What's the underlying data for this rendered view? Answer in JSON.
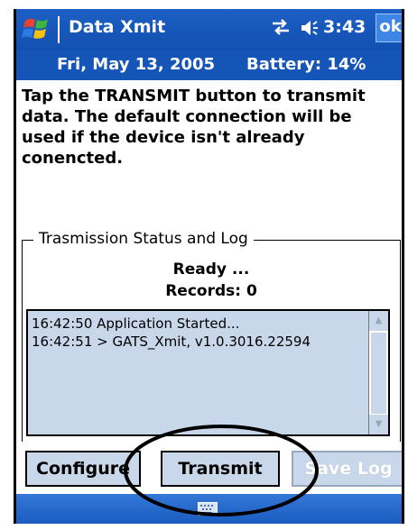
{
  "titlebar": {
    "app_title": "Data Xmit",
    "clock": "3:43",
    "ok_label": "ok",
    "icons": [
      "windows-start-icon",
      "connectivity-icon",
      "volume-icon"
    ]
  },
  "datebar": {
    "date": "Fri, May 13, 2005",
    "battery": "Battery: 14%"
  },
  "instruction": "Tap the TRANSMIT button to transmit data. The default connection will be used if the device isn't already conencted.",
  "status_group": {
    "legend": "Trasmission Status and Log",
    "status": "Ready ...",
    "records": "Records: 0"
  },
  "log": {
    "lines": [
      "16:42:50 Application Started...",
      "16:42:51 > GATS_Xmit, v1.0.3016.22594"
    ]
  },
  "buttons": {
    "configure": "Configure",
    "transmit": "Transmit",
    "save_log": "Save Log"
  },
  "menubar": {
    "icons": [
      "keyboard-icon"
    ]
  },
  "colors": {
    "titlebar_blue": "#1c5fc4",
    "button_fill": "#c9d7ea",
    "annotation": "#000000"
  }
}
